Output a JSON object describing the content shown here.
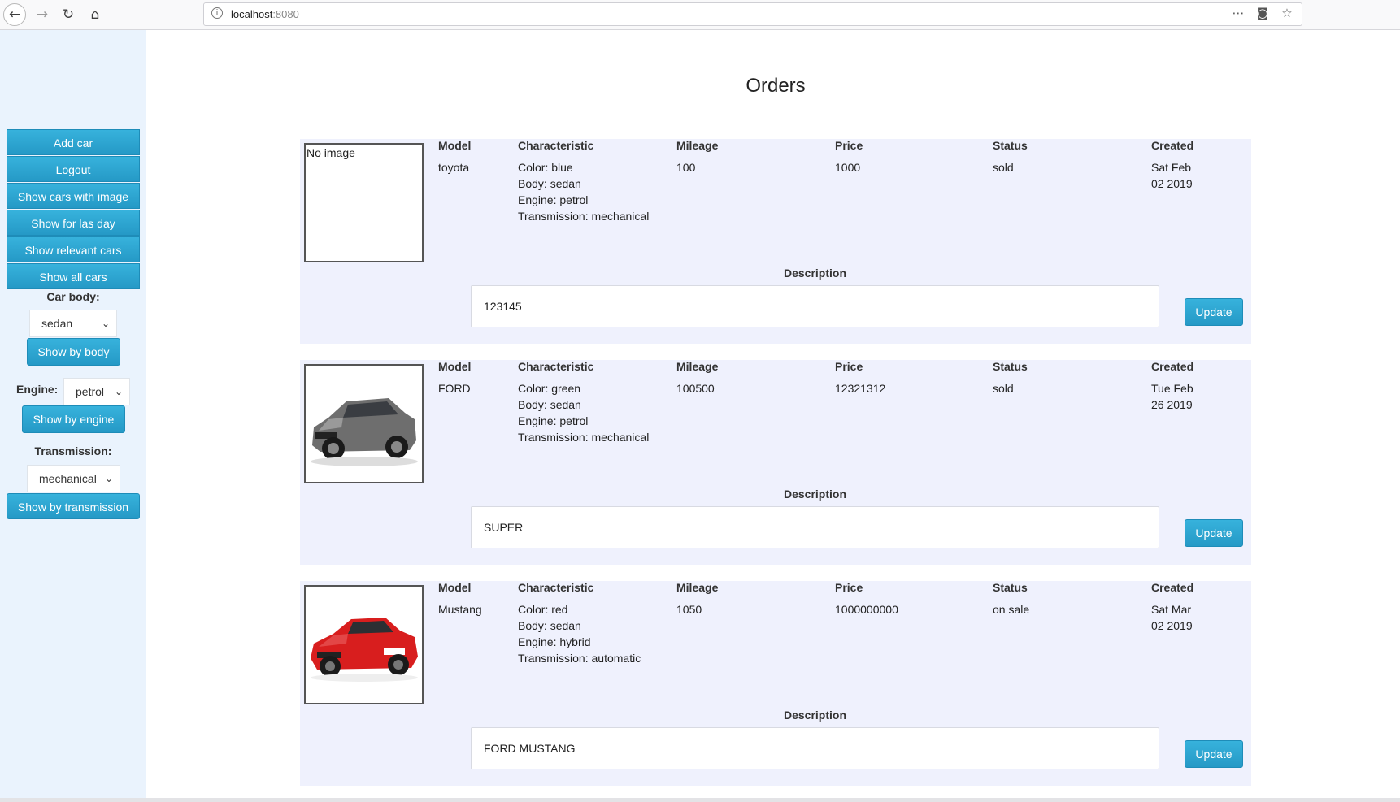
{
  "browser": {
    "url_host": "localhost",
    "url_port": ":8080"
  },
  "sidebar": {
    "buttons": [
      "Add car",
      "Logout",
      "Show cars with image",
      "Show for las day",
      "Show relevant cars",
      "Show all cars"
    ],
    "car_body_label": "Car body:",
    "car_body_value": "sedan",
    "show_by_body": "Show by body",
    "engine_label": "Engine:",
    "engine_value": "petrol",
    "show_by_engine": "Show by engine",
    "transmission_label": "Transmission:",
    "transmission_value": "mechanical",
    "show_by_transmission": "Show by transmission"
  },
  "page_title": "Orders",
  "headers": {
    "model": "Model",
    "characteristic": "Characteristic",
    "mileage": "Mileage",
    "price": "Price",
    "status": "Status",
    "created": "Created",
    "description": "Description",
    "update": "Update"
  },
  "orders": [
    {
      "image": "No image",
      "model": "toyota",
      "color": "Color: blue",
      "body": "Body: sedan",
      "engine": "Engine: petrol",
      "transmission": "Transmission: mechanical",
      "mileage": "100",
      "price": "1000",
      "status": "sold",
      "created_1": "Sat Feb",
      "created_2": "02 2019",
      "description": "123145"
    },
    {
      "image": "grey-suv-photo",
      "model": "FORD",
      "color": "Color: green",
      "body": "Body: sedan",
      "engine": "Engine: petrol",
      "transmission": "Transmission: mechanical",
      "mileage": "100500",
      "price": "12321312",
      "status": "sold",
      "created_1": "Tue Feb",
      "created_2": "26 2019",
      "description": "SUPER"
    },
    {
      "image": "red-mustang-photo",
      "model": "Mustang",
      "color": "Color: red",
      "body": "Body: sedan",
      "engine": "Engine: hybrid",
      "transmission": "Transmission: automatic",
      "mileage": "1050",
      "price": "1000000000",
      "status": "on sale",
      "created_1": "Sat Mar",
      "created_2": "02 2019",
      "description": "FORD MUSTANG"
    }
  ],
  "colors": {
    "accent": "#2fa8d3",
    "sidebar_bg": "#eaf3fd",
    "card_bg": "#eff1fd"
  }
}
